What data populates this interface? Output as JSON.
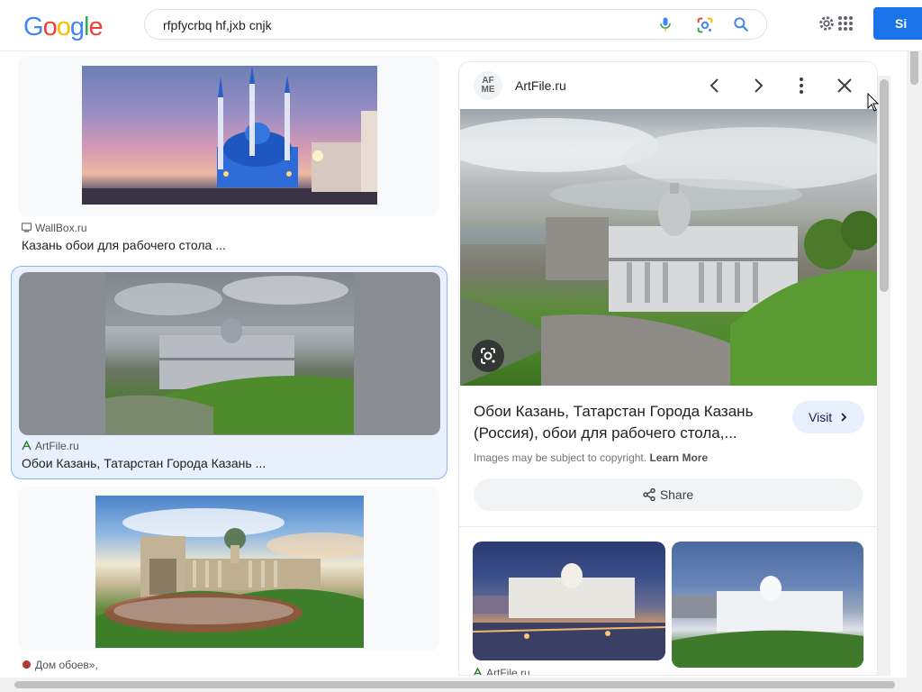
{
  "header": {
    "logo_letters": [
      "G",
      "o",
      "o",
      "g",
      "l",
      "e"
    ],
    "logo_colors": [
      "#4285f4",
      "#ea4335",
      "#fbbc05",
      "#4285f4",
      "#34a853",
      "#ea4335"
    ],
    "search_query": "rfpfycrbq hf,jxb cnjk",
    "signin_label": "Si"
  },
  "results": [
    {
      "source": "WallBox.ru",
      "title": "Казань обои для рабочего стола ..."
    },
    {
      "source": "ArtFile.ru",
      "title": "Обои Казань, Татарстан Города Казань ..."
    },
    {
      "source": "Дом обоев»,",
      "title": ""
    }
  ],
  "panel": {
    "site_logo_text": "AF\nME",
    "site_name": "ArtFile.ru",
    "title": "Обои Казань, Татарстан Города Казань (Россия), обои для рабочего стола,...",
    "visit_label": "Visit",
    "copyright_text": "Images may be subject to copyright.",
    "learn_more": "Learn More",
    "share_label": "Share",
    "related_source": "ArtFile.ru"
  },
  "colors": {
    "accent": "#1a73e8",
    "selected_bg": "#e8f0fe",
    "selected_border": "#8ab4f8"
  }
}
